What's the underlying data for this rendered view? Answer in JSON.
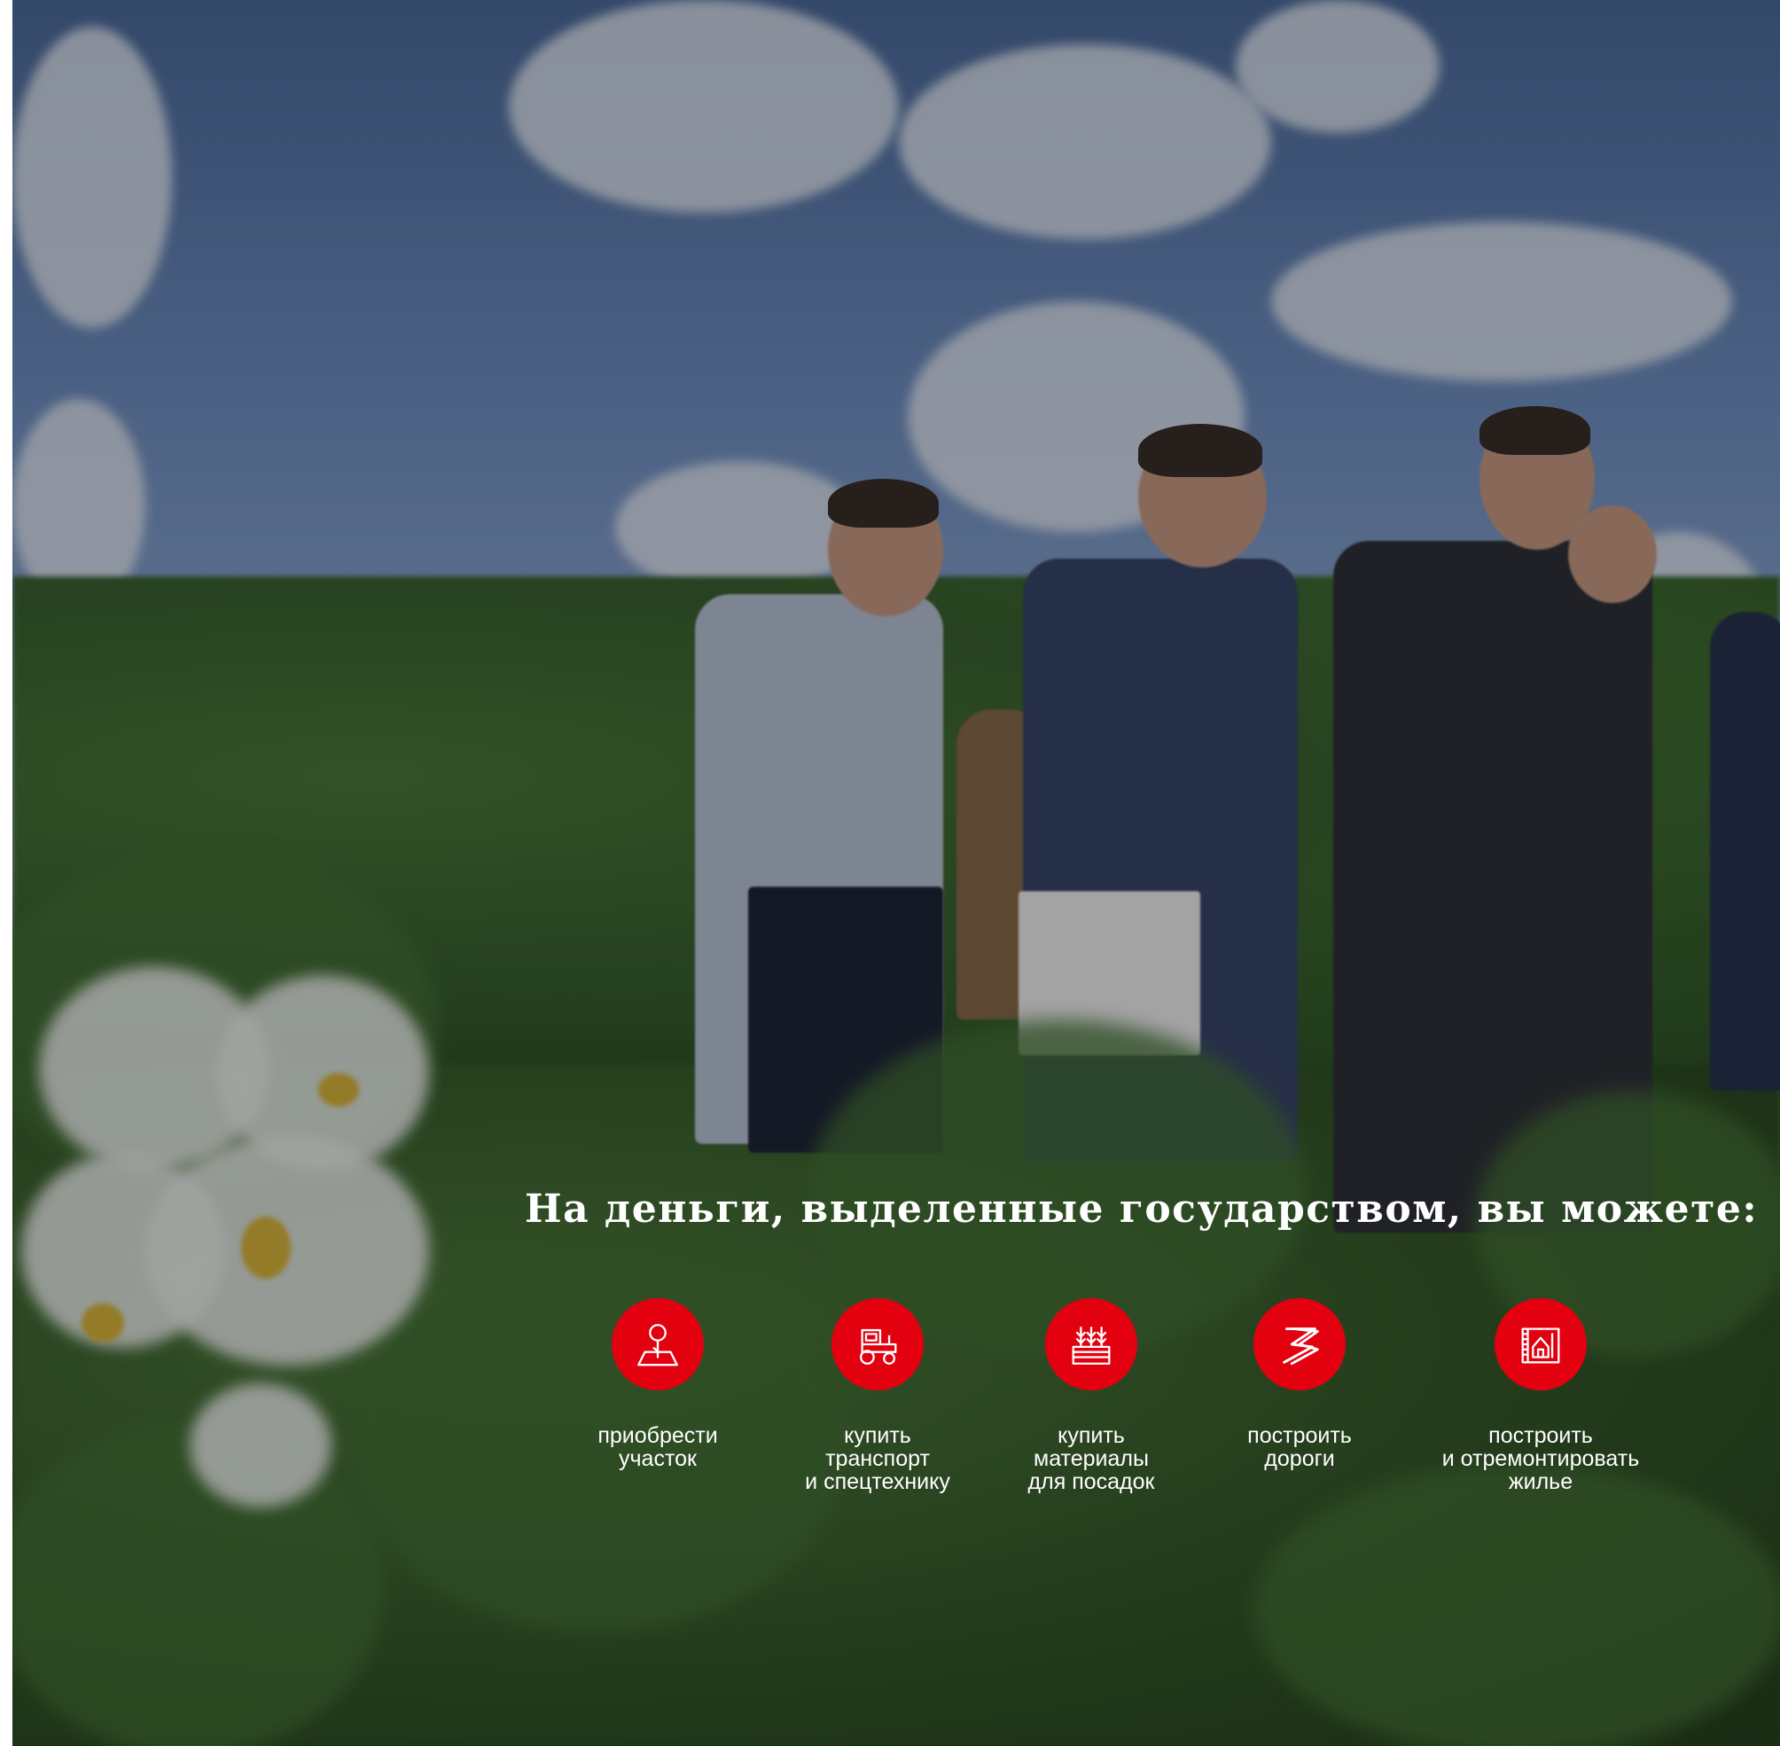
{
  "headline": "На деньги, выделенные государством, вы можете:",
  "accent_color": "#e3000f",
  "features": [
    {
      "icon": "land-plot-icon",
      "lines": [
        "приобрести",
        "участок"
      ]
    },
    {
      "icon": "tractor-icon",
      "lines": [
        "купить",
        "транспорт",
        "и спецтехнику"
      ]
    },
    {
      "icon": "seedlings-icon",
      "lines": [
        "купить",
        "материалы",
        "для посадок"
      ]
    },
    {
      "icon": "road-icon",
      "lines": [
        "построить",
        "дороги"
      ]
    },
    {
      "icon": "house-plan-icon",
      "lines": [
        "построить",
        "и отремонтировать",
        "жилье"
      ]
    }
  ]
}
